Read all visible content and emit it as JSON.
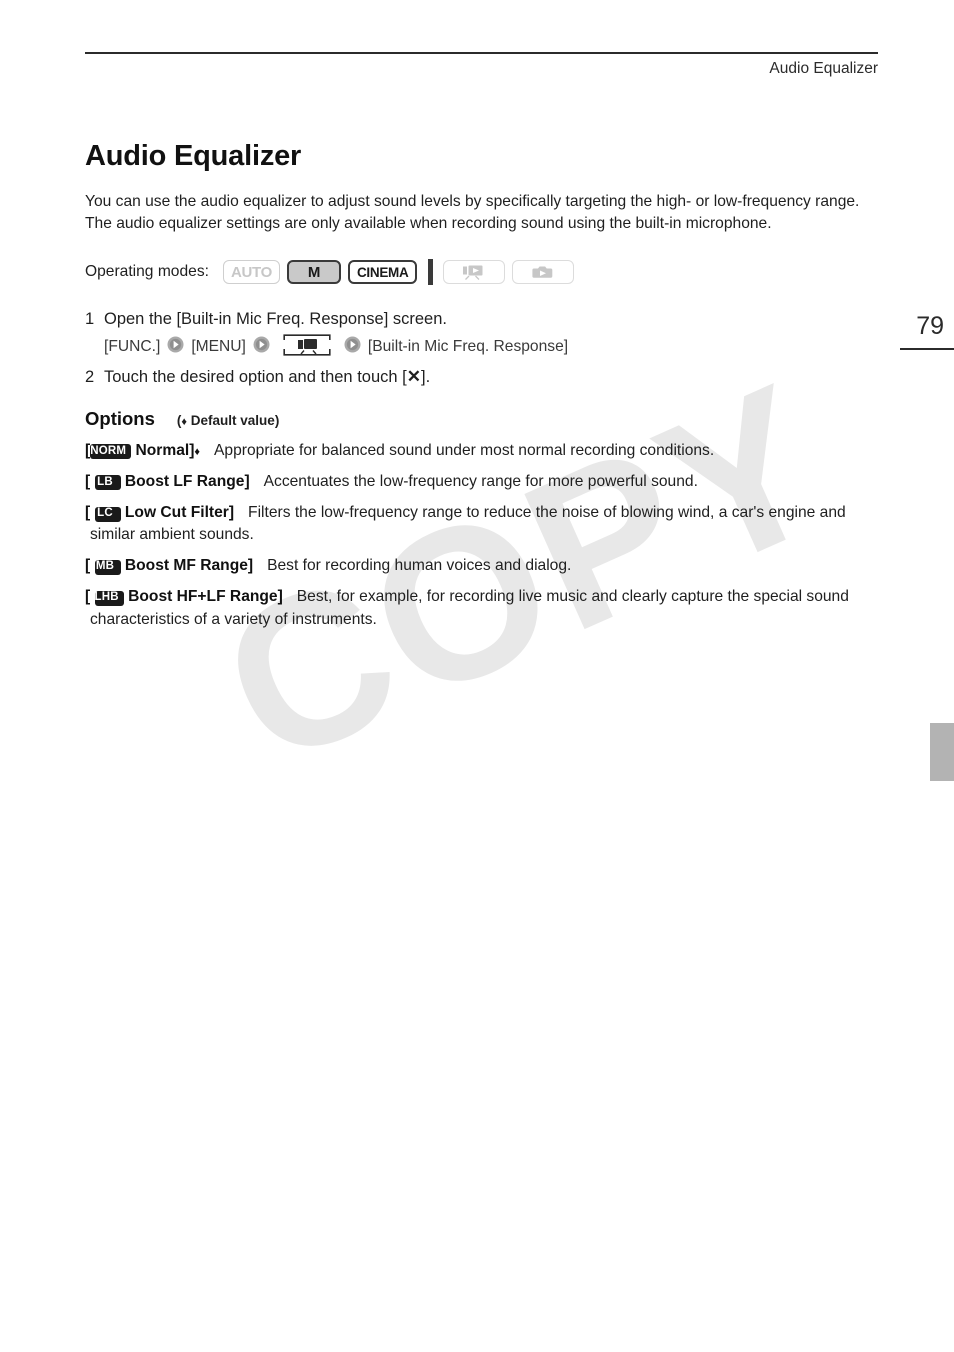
{
  "header": {
    "title": "Audio Equalizer"
  },
  "page": {
    "number": "79"
  },
  "watermark": {
    "text": "COPY"
  },
  "doc": {
    "title": "Audio Equalizer",
    "intro": "You can use the audio equalizer to adjust sound levels by specifically targeting the high- or low-frequency range. The audio equalizer settings are only available when recording sound using the built-in microphone."
  },
  "modes": {
    "label": "Operating modes:",
    "badges": [
      {
        "label": "AUTO",
        "state": "inactive",
        "icon": "auto-mode-badge"
      },
      {
        "label": "M",
        "state": "active",
        "icon": "manual-mode-badge"
      },
      {
        "label": "CINEMA",
        "state": "outline",
        "icon": "cinema-mode-badge"
      },
      {
        "label": "",
        "state": "inactive",
        "icon": "movie-playback-badge"
      },
      {
        "label": "",
        "state": "inactive",
        "icon": "photo-playback-badge"
      }
    ]
  },
  "steps": [
    {
      "num": "1",
      "text": "Open the [Built-in Mic Freq. Response] screen."
    },
    {
      "num": "2",
      "text_before": "Touch the desired option and then touch [",
      "glyph": "✕",
      "text_after": "]."
    }
  ],
  "breadcrumb": {
    "items": [
      {
        "type": "text",
        "label": "[FUNC.]"
      },
      {
        "type": "arrow",
        "label": "arrow-right-icon"
      },
      {
        "type": "text",
        "label": "[MENU]"
      },
      {
        "type": "arrow",
        "label": "arrow-right-icon"
      },
      {
        "type": "menu-tab",
        "label": "camcorder-menu-tab-icon"
      },
      {
        "type": "arrow",
        "label": "arrow-right-icon"
      },
      {
        "type": "text",
        "label": "[Built-in Mic Freq. Response]"
      }
    ]
  },
  "options": {
    "title": "Options",
    "default_note": "Default value",
    "default_marker": "♦",
    "items": [
      {
        "badge": "NORM",
        "open_bracket": "[",
        "label": "Normal]",
        "default_marker": "♦",
        "description": "Appropriate for balanced sound under most normal recording conditions."
      },
      {
        "badge": "LB",
        "open_bracket": "[",
        "label": "Boost LF Range]",
        "default_marker": "",
        "description": "Accentuates the low-frequency range for more powerful sound."
      },
      {
        "badge": "LC",
        "open_bracket": "[",
        "label": "Low Cut Filter]",
        "default_marker": "",
        "description": "Filters the low-frequency range to reduce the noise of blowing wind, a car's engine and similar ambient sounds."
      },
      {
        "badge": "MB",
        "open_bracket": "[",
        "label": "Boost MF Range]",
        "default_marker": "",
        "description": "Best for recording human voices and dialog."
      },
      {
        "badge": "LHB",
        "open_bracket": "[",
        "label": "Boost HF+LF Range]",
        "default_marker": "",
        "description": "Best, for example, for recording live music and clearly capture the special sound characteristics of a variety of instruments."
      }
    ]
  },
  "colors": {
    "text": "#1f1f1f",
    "rule": "#2b2b2b",
    "badge_bg": "#1a1a1a",
    "inactive": "#c7c7c7",
    "tab_marker": "#b3b3b3",
    "watermark": "#e8e8e8"
  }
}
